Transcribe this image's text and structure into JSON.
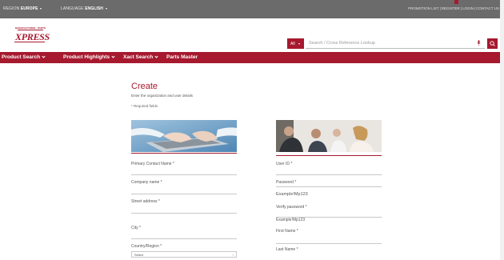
{
  "topbar": {
    "region_label": "REGION",
    "region_value": "EUROPE",
    "language_label": "LANGUAGE",
    "language_value": "ENGLISH",
    "links": [
      "PROMOTION LIST",
      "REGISTER",
      "LOGIN",
      "CONTACT US"
    ]
  },
  "logo": {
    "tagline": "MANUFACTURER · PARTS",
    "wordmark": "XPRESS"
  },
  "search": {
    "scope_label": "All",
    "placeholder": "Search / Cross Reference Lookup"
  },
  "nav": {
    "items": [
      "Product Search",
      "Product Highlights",
      "Xact Search",
      "Parts Master"
    ]
  },
  "form": {
    "title": "Create",
    "intro": "Enter the organization and user details",
    "required_note": "* Required fields",
    "left_fields": [
      "Primary Contact Name *",
      "Company name *",
      "Street address *",
      "City *",
      "Country/Region *"
    ],
    "country_select_value": "Select",
    "right_fields": [
      "User ID *",
      "Password *",
      "Verify password *",
      "First Name *",
      "Last Name *"
    ],
    "password_example": "Example!Mp123",
    "verify_example": "Example!Mp123"
  },
  "colors": {
    "brand": "#a6192e",
    "topbar": "#6b6b6b"
  }
}
